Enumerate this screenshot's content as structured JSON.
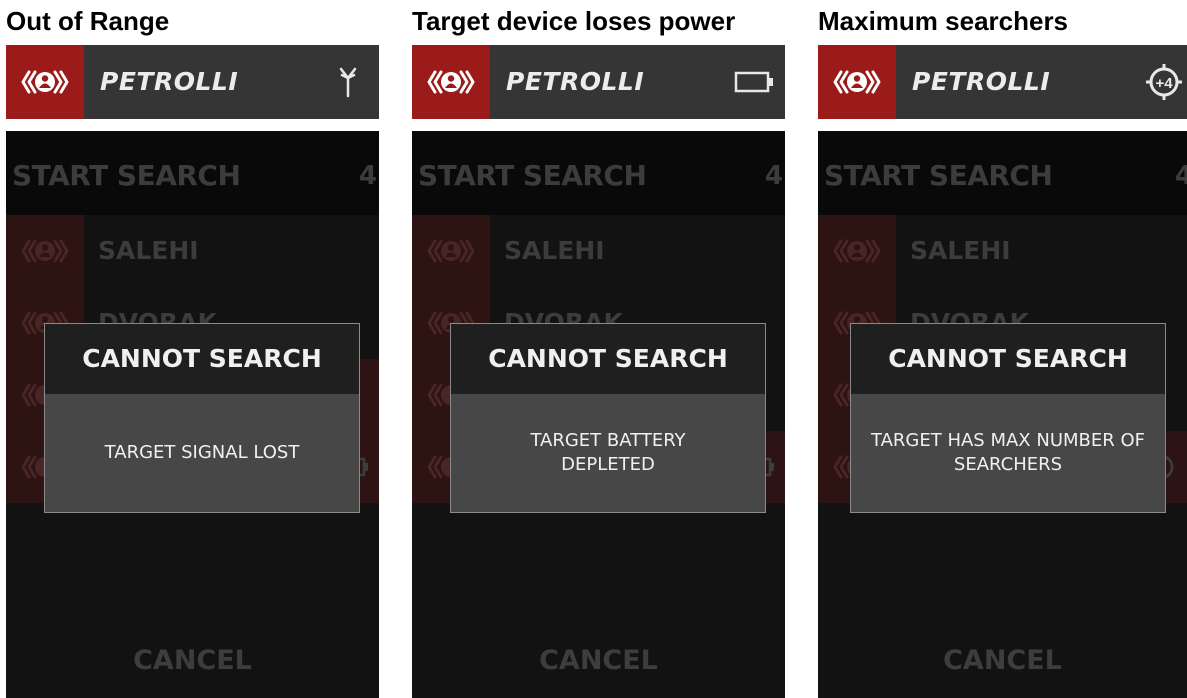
{
  "panels": [
    {
      "heading": "Out of Range",
      "user_name": "PETROLLI",
      "status_icon": "antenna-icon",
      "list_title": "START SEARCH",
      "list_count": "4",
      "rows": [
        {
          "name": "SALEHI",
          "icon": ""
        },
        {
          "name": "DVORAK",
          "icon": ""
        },
        {
          "name": "",
          "icon": "antenna-icon"
        },
        {
          "name": "",
          "icon": "battery-icon"
        }
      ],
      "dialog": {
        "title": "CANNOT SEARCH",
        "message": "TARGET SIGNAL LOST"
      },
      "cancel_label": "CANCEL"
    },
    {
      "heading": "Target device loses power",
      "user_name": "PETROLLI",
      "status_icon": "battery-icon",
      "list_title": "START SEARCH",
      "list_count": "4",
      "rows": [
        {
          "name": "SALEHI",
          "icon": ""
        },
        {
          "name": "DVORAK",
          "icon": ""
        },
        {
          "name": "",
          "icon": "antenna-icon"
        },
        {
          "name": "",
          "icon": "battery-icon"
        }
      ],
      "dialog": {
        "title": "CANNOT SEARCH",
        "message": "TARGET BATTERY DEPLETED"
      },
      "cancel_label": "CANCEL"
    },
    {
      "heading": "Maximum searchers",
      "user_name": "PETROLLI",
      "status_icon": "max-searchers-icon",
      "status_icon_text": "+4",
      "list_title": "START SEARCH",
      "list_count": "4",
      "rows": [
        {
          "name": "SALEHI",
          "icon": ""
        },
        {
          "name": "DVORAK",
          "icon": ""
        },
        {
          "name": "",
          "icon": ""
        },
        {
          "name": "",
          "icon": "max-searchers-icon"
        }
      ],
      "dialog": {
        "title": "CANNOT SEARCH",
        "message": "TARGET HAS MAX NUMBER OF SEARCHERS"
      },
      "cancel_label": "CANCEL"
    }
  ],
  "colors": {
    "brand_red": "#9b1b1b",
    "status_bar": "#353535",
    "screen_bg": "#121212",
    "dialog_bg": "#474747",
    "dialog_title_bg": "#1f1f1f"
  }
}
